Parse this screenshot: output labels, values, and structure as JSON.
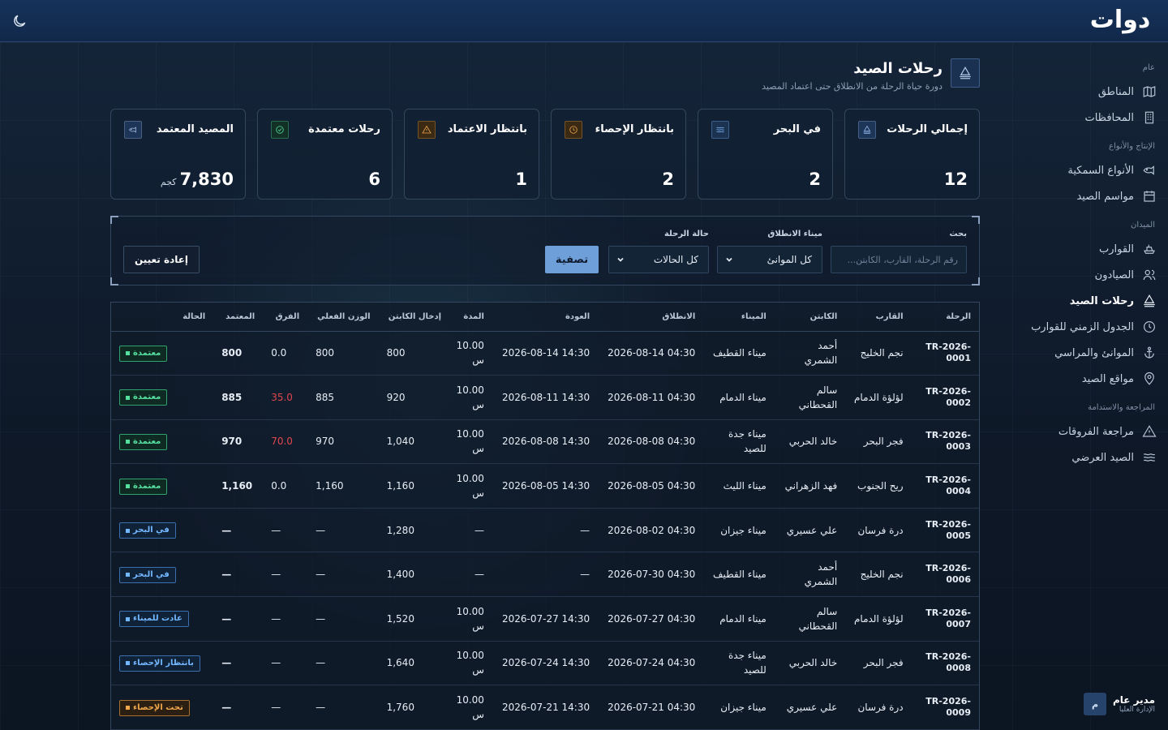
{
  "header": {
    "logo_text": "دوات",
    "theme_toggle_icon": "moon-icon"
  },
  "sidebar": {
    "groups": [
      {
        "title": "عام",
        "items": [
          {
            "label": "المناطق",
            "icon": "map-icon"
          },
          {
            "label": "المحافظات",
            "icon": "building-icon"
          }
        ]
      },
      {
        "title": "الإنتاج والأنواع",
        "items": [
          {
            "label": "الأنواع السمكية",
            "icon": "fish-icon"
          },
          {
            "label": "مواسم الصيد",
            "icon": "calendar-icon"
          }
        ]
      },
      {
        "title": "الميدان",
        "items": [
          {
            "label": "القوارب",
            "icon": "boat-icon"
          },
          {
            "label": "الصيادون",
            "icon": "users-icon"
          },
          {
            "label": "رحلات الصيد",
            "icon": "sail-icon",
            "active": true
          },
          {
            "label": "الجدول الزمني للقوارب",
            "icon": "clock-icon"
          },
          {
            "label": "الموانئ والمراسي",
            "icon": "anchor-icon"
          },
          {
            "label": "مواقع الصيد",
            "icon": "location-pin-icon"
          }
        ]
      },
      {
        "title": "المراجعة والاستدامة",
        "items": [
          {
            "label": "مراجعة الفروقات",
            "icon": "warning-icon"
          },
          {
            "label": "الصيد العرضي",
            "icon": "waves-icon"
          }
        ]
      }
    ],
    "user": {
      "initial": "م",
      "name": "مدير عام",
      "role": "الإدارة العليا"
    }
  },
  "page": {
    "title": "رحلات الصيد",
    "subtitle": "دورة حياة الرحلة من الانطلاق حتى اعتماد المصيد",
    "icon": "sail-icon"
  },
  "kpis": [
    {
      "label": "إجمالي الرحلات",
      "value": "12",
      "icon": "sail-icon",
      "color": "#8fb4e8",
      "bg": "#1d3556"
    },
    {
      "label": "في البحر",
      "value": "2",
      "icon": "waves-icon",
      "color": "#7fb6ff",
      "bg": "#1b3350"
    },
    {
      "label": "بانتظار الإحصاء",
      "value": "2",
      "icon": "clock-icon",
      "color": "#f0a64b",
      "bg": "#3a2a14"
    },
    {
      "label": "بانتظار الاعتماد",
      "value": "1",
      "icon": "warning-icon",
      "color": "#f0a64b",
      "bg": "#3a2a14"
    },
    {
      "label": "رحلات معتمدة",
      "value": "6",
      "icon": "check-circle-icon",
      "color": "#55e0a0",
      "bg": "#123026"
    },
    {
      "label": "المصيد المعتمد",
      "value": "7,830",
      "unit": "كجم",
      "icon": "fish-icon",
      "color": "#9fb8da",
      "bg": "#1d3556"
    }
  ],
  "filters": {
    "search_label": "بحث",
    "search_placeholder": "رقم الرحلة، القارب، الكابتن...",
    "port_label": "ميناء الانطلاق",
    "port_value": "كل الموانئ",
    "status_label": "حالة الرحلة",
    "status_value": "كل الحالات",
    "filter_button": "تصفية",
    "reset_button": "إعادة تعيين"
  },
  "table": {
    "columns": [
      "الرحلة",
      "القارب",
      "الكابتن",
      "الميناء",
      "الانطلاق",
      "العودة",
      "المدة",
      "إدخال الكابتن",
      "الوزن الفعلي",
      "الفرق",
      "المعتمد",
      "الحالة"
    ],
    "rows": [
      {
        "trip": "TR-2026-0001",
        "boat": "نجم الخليج",
        "captain": "أحمد الشمري",
        "port": "ميناء القطيف",
        "depart": "2026-08-14 04:30",
        "return": "2026-08-14 14:30",
        "duration": "10.00 س",
        "captain_entry": "800",
        "actual": "800",
        "diff": "0.0",
        "diff_red": false,
        "approved": "800",
        "status": "معتمدة",
        "status_tone": "green"
      },
      {
        "trip": "TR-2026-0002",
        "boat": "لؤلؤة الدمام",
        "captain": "سالم القحطاني",
        "port": "ميناء الدمام",
        "depart": "2026-08-11 04:30",
        "return": "2026-08-11 14:30",
        "duration": "10.00 س",
        "captain_entry": "920",
        "actual": "885",
        "diff": "35.0",
        "diff_red": true,
        "approved": "885",
        "status": "معتمدة",
        "status_tone": "green"
      },
      {
        "trip": "TR-2026-0003",
        "boat": "فجر البحر",
        "captain": "خالد الحربي",
        "port": "ميناء جدة للصيد",
        "depart": "2026-08-08 04:30",
        "return": "2026-08-08 14:30",
        "duration": "10.00 س",
        "captain_entry": "1,040",
        "actual": "970",
        "diff": "70.0",
        "diff_red": true,
        "approved": "970",
        "status": "معتمدة",
        "status_tone": "green"
      },
      {
        "trip": "TR-2026-0004",
        "boat": "ريح الجنوب",
        "captain": "فهد الزهراني",
        "port": "ميناء الليث",
        "depart": "2026-08-05 04:30",
        "return": "2026-08-05 14:30",
        "duration": "10.00 س",
        "captain_entry": "1,160",
        "actual": "1,160",
        "diff": "0.0",
        "diff_red": false,
        "approved": "1,160",
        "status": "معتمدة",
        "status_tone": "green"
      },
      {
        "trip": "TR-2026-0005",
        "boat": "درة فرسان",
        "captain": "علي عسيري",
        "port": "ميناء جيزان",
        "depart": "2026-08-02 04:30",
        "return": "—",
        "duration": "—",
        "captain_entry": "1,280",
        "actual": "—",
        "diff": "—",
        "diff_red": false,
        "approved": "—",
        "status": "في البحر",
        "status_tone": "blue"
      },
      {
        "trip": "TR-2026-0006",
        "boat": "نجم الخليج",
        "captain": "أحمد الشمري",
        "port": "ميناء القطيف",
        "depart": "2026-07-30 04:30",
        "return": "—",
        "duration": "—",
        "captain_entry": "1,400",
        "actual": "—",
        "diff": "—",
        "diff_red": false,
        "approved": "—",
        "status": "في البحر",
        "status_tone": "blue"
      },
      {
        "trip": "TR-2026-0007",
        "boat": "لؤلؤة الدمام",
        "captain": "سالم القحطاني",
        "port": "ميناء الدمام",
        "depart": "2026-07-27 04:30",
        "return": "2026-07-27 14:30",
        "duration": "10.00 س",
        "captain_entry": "1,520",
        "actual": "—",
        "diff": "—",
        "diff_red": false,
        "approved": "—",
        "status": "عادت للميناء",
        "status_tone": "blue"
      },
      {
        "trip": "TR-2026-0008",
        "boat": "فجر البحر",
        "captain": "خالد الحربي",
        "port": "ميناء جدة للصيد",
        "depart": "2026-07-24 04:30",
        "return": "2026-07-24 14:30",
        "duration": "10.00 س",
        "captain_entry": "1,640",
        "actual": "—",
        "diff": "—",
        "diff_red": false,
        "approved": "—",
        "status": "بانتظار الإحصاء",
        "status_tone": "blue"
      },
      {
        "trip": "TR-2026-0009",
        "boat": "درة فرسان",
        "captain": "علي عسيري",
        "port": "ميناء جيزان",
        "depart": "2026-07-21 04:30",
        "return": "2026-07-21 14:30",
        "duration": "10.00 س",
        "captain_entry": "1,760",
        "actual": "—",
        "diff": "—",
        "diff_red": false,
        "approved": "—",
        "status": "تحت الإحصاء",
        "status_tone": "orange"
      }
    ]
  }
}
